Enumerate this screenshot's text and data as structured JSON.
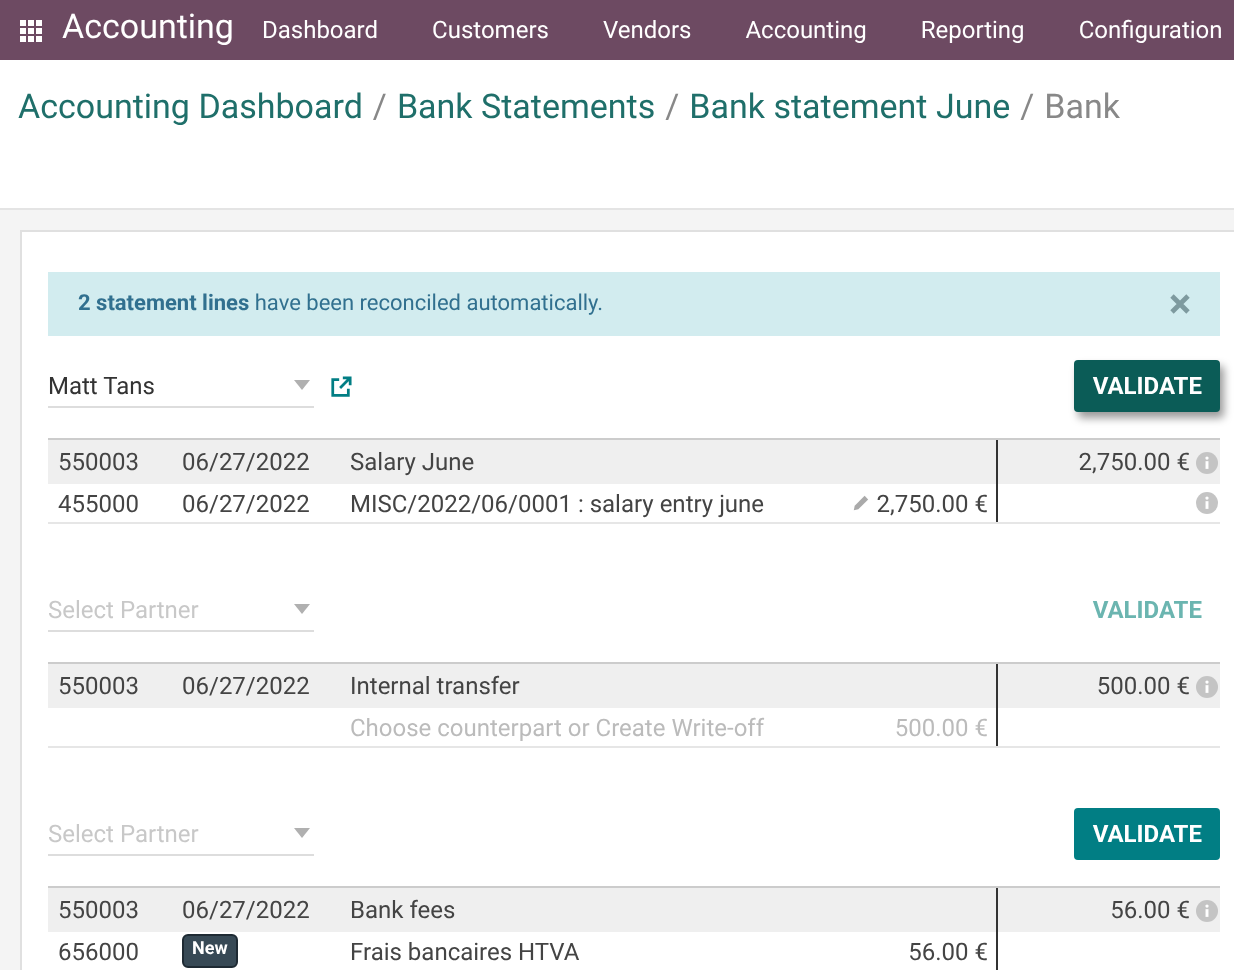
{
  "navbar": {
    "app_title": "Accounting",
    "menu": [
      {
        "label": "Dashboard"
      },
      {
        "label": "Customers"
      },
      {
        "label": "Vendors"
      },
      {
        "label": "Accounting"
      },
      {
        "label": "Reporting"
      },
      {
        "label": "Configuration"
      }
    ]
  },
  "breadcrumb_separator": "/",
  "breadcrumb": [
    {
      "label": "Accounting Dashboard",
      "kind": "link"
    },
    {
      "label": "Bank Statements",
      "kind": "link"
    },
    {
      "label": "Bank statement June",
      "kind": "link"
    },
    {
      "label": "Bank",
      "kind": "current"
    }
  ],
  "alert": {
    "text": "**2 statement lines** have been reconciled automatically."
  },
  "blocks": [
    {
      "partner": {
        "value": "Matt Tans"
      },
      "validate": {
        "label": "VALIDATE",
        "kind": "hovered"
      },
      "statement": {
        "account": "550003",
        "date": "06/27/2022",
        "label": "Salary June",
        "amount": "2,750.00 €"
      },
      "lines": [
        {
          "kind": "move",
          "account": "455000",
          "date": "06/27/2022",
          "label": "MISC/2022/06/0001 : salary entry june",
          "amount": "2,750.00 €"
        }
      ]
    },
    {
      "partner": {
        "placeholder": "Select Partner"
      },
      "validate": {
        "label": "VALIDATE",
        "kind": "link"
      },
      "statement": {
        "account": "550003",
        "date": "06/27/2022",
        "label": "Internal transfer",
        "amount": "500.00 €"
      },
      "lines": [
        {
          "kind": "open",
          "label": "Choose counterpart or Create Write-off",
          "amount": "500.00 €"
        }
      ]
    },
    {
      "partner": {
        "placeholder": "Select Partner"
      },
      "validate": {
        "label": "VALIDATE",
        "kind": "primary"
      },
      "statement": {
        "account": "550003",
        "date": "06/27/2022",
        "label": "Bank fees",
        "amount": "56.00 €"
      },
      "lines": [
        {
          "kind": "new",
          "account": "656000",
          "badge": "New",
          "label": "Frais bancaires HTVA",
          "amount": "56.00 €"
        }
      ]
    }
  ]
}
